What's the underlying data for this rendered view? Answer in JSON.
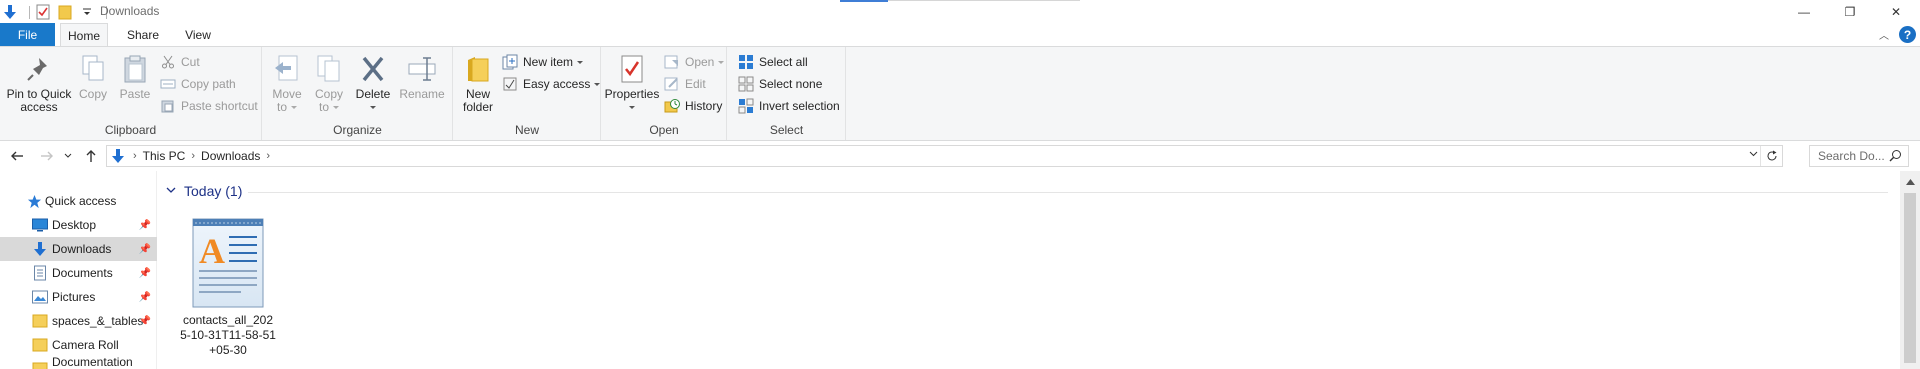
{
  "window": {
    "title": "Downloads",
    "controls": {
      "minimize": "—",
      "maximize": "❐",
      "close": "✕"
    }
  },
  "ribbon_tabs": {
    "file": "File",
    "home": "Home",
    "share": "Share",
    "view": "View"
  },
  "ribbon": {
    "clipboard": {
      "label": "Clipboard",
      "pin_line1": "Pin to Quick",
      "pin_line2": "access",
      "copy": "Copy",
      "paste": "Paste",
      "cut": "Cut",
      "copy_path": "Copy path",
      "paste_shortcut": "Paste shortcut"
    },
    "organize": {
      "label": "Organize",
      "move_to_line1": "Move",
      "move_to_line2": "to",
      "copy_to_line1": "Copy",
      "copy_to_line2": "to",
      "delete": "Delete",
      "rename": "Rename"
    },
    "new": {
      "label": "New",
      "new_folder_line1": "New",
      "new_folder_line2": "folder",
      "new_item": "New item",
      "easy_access": "Easy access"
    },
    "open": {
      "label": "Open",
      "properties": "Properties",
      "open": "Open",
      "edit": "Edit",
      "history": "History"
    },
    "select": {
      "label": "Select",
      "select_all": "Select all",
      "select_none": "Select none",
      "invert_selection": "Invert selection"
    }
  },
  "address_bar": {
    "crumbs": [
      "This PC",
      "Downloads"
    ],
    "search_placeholder": "Search Do..."
  },
  "nav_pane": {
    "quick_access": "Quick access",
    "items": [
      {
        "label": "Desktop",
        "icon": "desktop-icon",
        "pinned": true
      },
      {
        "label": "Downloads",
        "icon": "downloads-icon",
        "pinned": true,
        "selected": true
      },
      {
        "label": "Documents",
        "icon": "documents-icon",
        "pinned": true
      },
      {
        "label": "Pictures",
        "icon": "pictures-icon",
        "pinned": true
      },
      {
        "label": "spaces_&_tables",
        "icon": "folder-icon",
        "pinned": true
      },
      {
        "label": "Camera Roll",
        "icon": "folder-icon",
        "pinned": false
      },
      {
        "label": "Documentation im...",
        "icon": "folder-icon",
        "pinned": false
      }
    ]
  },
  "content": {
    "group_header": "Today (1)",
    "files": [
      {
        "name": "contacts_all_2025-10-31T11-58-51+05-30",
        "icon": "wordpad-document-icon"
      }
    ]
  },
  "colors": {
    "accent": "#1979ca",
    "group_header": "#1e3287",
    "selected_nav": "#d9d9d9",
    "ribbon_bg": "#f5f6f7"
  }
}
